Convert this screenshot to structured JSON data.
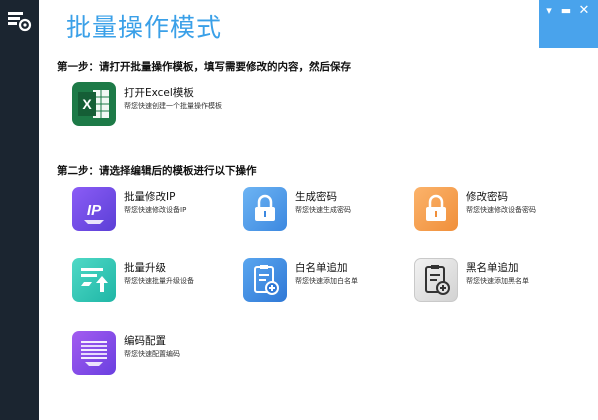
{
  "app": {
    "title": "批量操作模式"
  },
  "window": {
    "accent": "#49a3ec"
  },
  "step1": {
    "label": "第一步：请打开批量操作模板，填写需要修改的内容，然后保存",
    "item": {
      "title": "打开Excel模板",
      "desc": "帮您快速创建一个批量操作模板",
      "icon": "excel-icon"
    }
  },
  "step2": {
    "label": "第二步：请选择编辑后的模板进行以下操作",
    "items": [
      {
        "title": "批量修改IP",
        "desc": "帮您快速修改设备IP",
        "icon": "ip-icon"
      },
      {
        "title": "生成密码",
        "desc": "帮您快速生成密码",
        "icon": "lock-icon"
      },
      {
        "title": "修改密码",
        "desc": "帮您快速修改设备密码",
        "icon": "lock-icon"
      },
      {
        "title": "批量升级",
        "desc": "帮您快速批量升级设备",
        "icon": "upgrade-icon"
      },
      {
        "title": "白名单追加",
        "desc": "帮您快速添加白名单",
        "icon": "whitelist-icon"
      },
      {
        "title": "黑名单追加",
        "desc": "帮您快速添加黑名单",
        "icon": "blacklist-icon"
      },
      {
        "title": "编码配置",
        "desc": "帮您快速配置编码",
        "icon": "encoding-icon"
      }
    ]
  }
}
